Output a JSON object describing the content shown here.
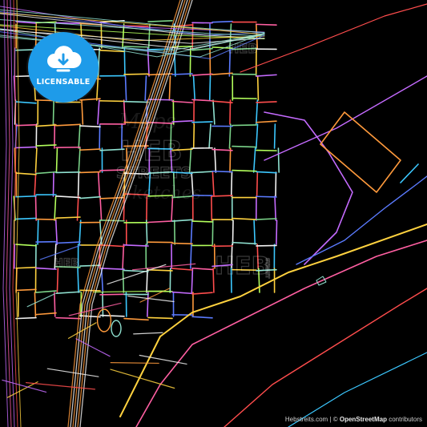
{
  "badge": {
    "label": "LICENSABLE",
    "icon": "cloud-download-icon",
    "color": "#1e9be9"
  },
  "watermark": {
    "brand": "HEB",
    "script_top": "Maps",
    "word1": "STREETS",
    "script_bottom": "Sketches",
    "street_small": "STREET"
  },
  "attribution": {
    "site": "Hebstreits.com",
    "separator": " | © ",
    "osm": "OpenStreetMap",
    "contributors": " contributors"
  },
  "palette": [
    "#ff4d4d",
    "#ff9a3c",
    "#ffd23f",
    "#7bd389",
    "#3cc8ff",
    "#5b7bff",
    "#c56bff",
    "#ff5fa2",
    "#f2f2f2",
    "#8fe1d0",
    "#b3ff5c"
  ]
}
